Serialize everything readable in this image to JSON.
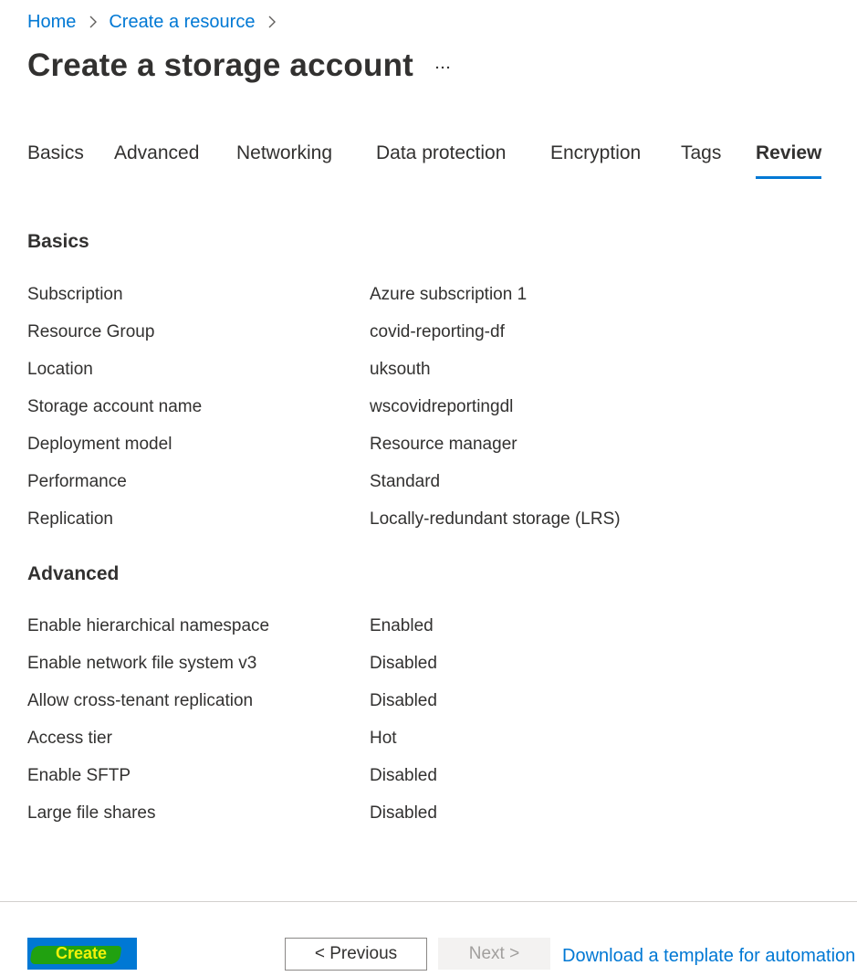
{
  "breadcrumb": {
    "items": [
      "Home",
      "Create a resource"
    ]
  },
  "page": {
    "title": "Create a storage account",
    "more_icon": "more-ellipsis-icon"
  },
  "tabs": [
    {
      "label": "Basics",
      "active": false
    },
    {
      "label": "Advanced",
      "active": false
    },
    {
      "label": "Networking",
      "active": false
    },
    {
      "label": "Data protection",
      "active": false
    },
    {
      "label": "Encryption",
      "active": false
    },
    {
      "label": "Tags",
      "active": false
    },
    {
      "label": "Review",
      "active": true
    }
  ],
  "basics": {
    "heading": "Basics",
    "rows": [
      {
        "label": "Subscription",
        "value": "Azure subscription 1"
      },
      {
        "label": "Resource Group",
        "value": "covid-reporting-df"
      },
      {
        "label": "Location",
        "value": "uksouth"
      },
      {
        "label": "Storage account name",
        "value": "wscovidreportingdl"
      },
      {
        "label": "Deployment model",
        "value": "Resource manager"
      },
      {
        "label": "Performance",
        "value": "Standard"
      },
      {
        "label": "Replication",
        "value": "Locally-redundant storage (LRS)"
      }
    ]
  },
  "advanced": {
    "heading": "Advanced",
    "rows": [
      {
        "label": "Enable hierarchical namespace",
        "value": "Enabled"
      },
      {
        "label": "Enable network file system v3",
        "value": "Disabled"
      },
      {
        "label": "Allow cross-tenant replication",
        "value": "Disabled"
      },
      {
        "label": "Access tier",
        "value": "Hot"
      },
      {
        "label": "Enable SFTP",
        "value": "Disabled"
      },
      {
        "label": "Large file shares",
        "value": "Disabled"
      }
    ]
  },
  "footer": {
    "create_label": "Create",
    "previous_label": "< Previous",
    "next_label": "Next >",
    "download_link": "Download a template for automation"
  },
  "colors": {
    "accent": "#0078d4",
    "create_highlight": "#21a110",
    "create_text": "#f2f20a"
  }
}
